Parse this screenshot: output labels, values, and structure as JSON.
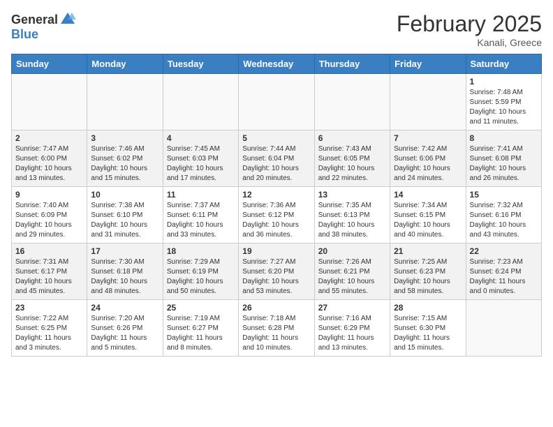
{
  "header": {
    "logo_general": "General",
    "logo_blue": "Blue",
    "month": "February 2025",
    "location": "Kanali, Greece"
  },
  "days_of_week": [
    "Sunday",
    "Monday",
    "Tuesday",
    "Wednesday",
    "Thursday",
    "Friday",
    "Saturday"
  ],
  "weeks": [
    {
      "shade": false,
      "days": [
        {
          "num": "",
          "info": ""
        },
        {
          "num": "",
          "info": ""
        },
        {
          "num": "",
          "info": ""
        },
        {
          "num": "",
          "info": ""
        },
        {
          "num": "",
          "info": ""
        },
        {
          "num": "",
          "info": ""
        },
        {
          "num": "1",
          "info": "Sunrise: 7:48 AM\nSunset: 5:59 PM\nDaylight: 10 hours\nand 11 minutes."
        }
      ]
    },
    {
      "shade": true,
      "days": [
        {
          "num": "2",
          "info": "Sunrise: 7:47 AM\nSunset: 6:00 PM\nDaylight: 10 hours\nand 13 minutes."
        },
        {
          "num": "3",
          "info": "Sunrise: 7:46 AM\nSunset: 6:02 PM\nDaylight: 10 hours\nand 15 minutes."
        },
        {
          "num": "4",
          "info": "Sunrise: 7:45 AM\nSunset: 6:03 PM\nDaylight: 10 hours\nand 17 minutes."
        },
        {
          "num": "5",
          "info": "Sunrise: 7:44 AM\nSunset: 6:04 PM\nDaylight: 10 hours\nand 20 minutes."
        },
        {
          "num": "6",
          "info": "Sunrise: 7:43 AM\nSunset: 6:05 PM\nDaylight: 10 hours\nand 22 minutes."
        },
        {
          "num": "7",
          "info": "Sunrise: 7:42 AM\nSunset: 6:06 PM\nDaylight: 10 hours\nand 24 minutes."
        },
        {
          "num": "8",
          "info": "Sunrise: 7:41 AM\nSunset: 6:08 PM\nDaylight: 10 hours\nand 26 minutes."
        }
      ]
    },
    {
      "shade": false,
      "days": [
        {
          "num": "9",
          "info": "Sunrise: 7:40 AM\nSunset: 6:09 PM\nDaylight: 10 hours\nand 29 minutes."
        },
        {
          "num": "10",
          "info": "Sunrise: 7:38 AM\nSunset: 6:10 PM\nDaylight: 10 hours\nand 31 minutes."
        },
        {
          "num": "11",
          "info": "Sunrise: 7:37 AM\nSunset: 6:11 PM\nDaylight: 10 hours\nand 33 minutes."
        },
        {
          "num": "12",
          "info": "Sunrise: 7:36 AM\nSunset: 6:12 PM\nDaylight: 10 hours\nand 36 minutes."
        },
        {
          "num": "13",
          "info": "Sunrise: 7:35 AM\nSunset: 6:13 PM\nDaylight: 10 hours\nand 38 minutes."
        },
        {
          "num": "14",
          "info": "Sunrise: 7:34 AM\nSunset: 6:15 PM\nDaylight: 10 hours\nand 40 minutes."
        },
        {
          "num": "15",
          "info": "Sunrise: 7:32 AM\nSunset: 6:16 PM\nDaylight: 10 hours\nand 43 minutes."
        }
      ]
    },
    {
      "shade": true,
      "days": [
        {
          "num": "16",
          "info": "Sunrise: 7:31 AM\nSunset: 6:17 PM\nDaylight: 10 hours\nand 45 minutes."
        },
        {
          "num": "17",
          "info": "Sunrise: 7:30 AM\nSunset: 6:18 PM\nDaylight: 10 hours\nand 48 minutes."
        },
        {
          "num": "18",
          "info": "Sunrise: 7:29 AM\nSunset: 6:19 PM\nDaylight: 10 hours\nand 50 minutes."
        },
        {
          "num": "19",
          "info": "Sunrise: 7:27 AM\nSunset: 6:20 PM\nDaylight: 10 hours\nand 53 minutes."
        },
        {
          "num": "20",
          "info": "Sunrise: 7:26 AM\nSunset: 6:21 PM\nDaylight: 10 hours\nand 55 minutes."
        },
        {
          "num": "21",
          "info": "Sunrise: 7:25 AM\nSunset: 6:23 PM\nDaylight: 10 hours\nand 58 minutes."
        },
        {
          "num": "22",
          "info": "Sunrise: 7:23 AM\nSunset: 6:24 PM\nDaylight: 11 hours\nand 0 minutes."
        }
      ]
    },
    {
      "shade": false,
      "days": [
        {
          "num": "23",
          "info": "Sunrise: 7:22 AM\nSunset: 6:25 PM\nDaylight: 11 hours\nand 3 minutes."
        },
        {
          "num": "24",
          "info": "Sunrise: 7:20 AM\nSunset: 6:26 PM\nDaylight: 11 hours\nand 5 minutes."
        },
        {
          "num": "25",
          "info": "Sunrise: 7:19 AM\nSunset: 6:27 PM\nDaylight: 11 hours\nand 8 minutes."
        },
        {
          "num": "26",
          "info": "Sunrise: 7:18 AM\nSunset: 6:28 PM\nDaylight: 11 hours\nand 10 minutes."
        },
        {
          "num": "27",
          "info": "Sunrise: 7:16 AM\nSunset: 6:29 PM\nDaylight: 11 hours\nand 13 minutes."
        },
        {
          "num": "28",
          "info": "Sunrise: 7:15 AM\nSunset: 6:30 PM\nDaylight: 11 hours\nand 15 minutes."
        },
        {
          "num": "",
          "info": ""
        }
      ]
    }
  ]
}
